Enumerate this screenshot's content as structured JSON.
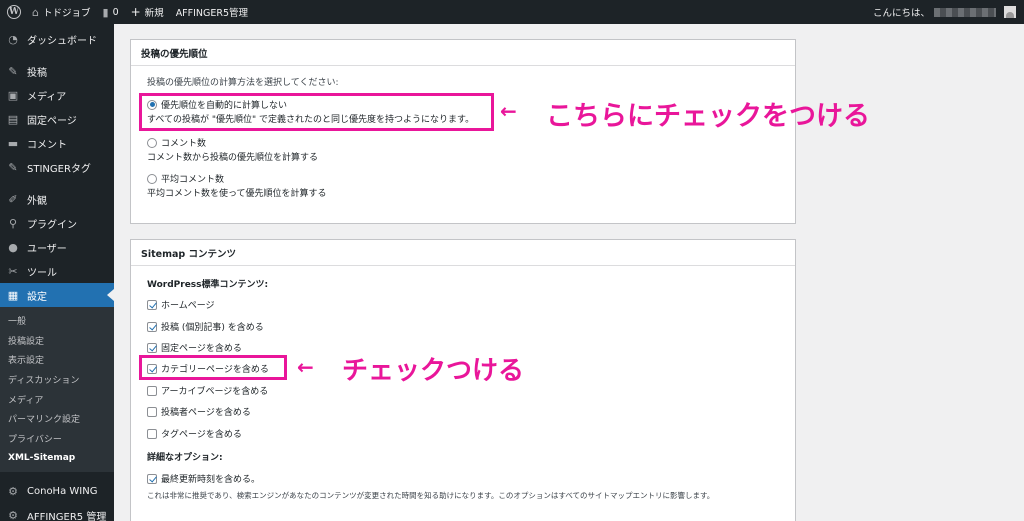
{
  "adminbar": {
    "site_name": "トドジョブ",
    "comments_count": "0",
    "new_label": "新規",
    "affinger_label": "AFFINGER5管理",
    "greeting": "こんにちは、"
  },
  "sidebar": {
    "items": [
      {
        "label": "ダッシュボード",
        "icon": "dashboard-icon",
        "glyph": "◔"
      },
      {
        "label": "投稿",
        "icon": "pin-icon",
        "glyph": "✎"
      },
      {
        "label": "メディア",
        "icon": "media-icon",
        "glyph": "▣"
      },
      {
        "label": "固定ページ",
        "icon": "page-icon",
        "glyph": "▤"
      },
      {
        "label": "コメント",
        "icon": "comment-icon",
        "glyph": "▬"
      },
      {
        "label": "STINGERタグ",
        "icon": "pin-icon",
        "glyph": "✎"
      },
      {
        "label": "外観",
        "icon": "brush-icon",
        "glyph": "✐"
      },
      {
        "label": "プラグイン",
        "icon": "plugin-icon",
        "glyph": "⚲"
      },
      {
        "label": "ユーザー",
        "icon": "user-icon",
        "glyph": "●"
      },
      {
        "label": "ツール",
        "icon": "wrench-icon",
        "glyph": "✂"
      },
      {
        "label": "設定",
        "icon": "settings-icon",
        "glyph": "▦"
      }
    ],
    "submenu": [
      "一般",
      "投稿設定",
      "表示設定",
      "ディスカッション",
      "メディア",
      "パーマリンク設定",
      "プライバシー",
      "XML-Sitemap"
    ],
    "bottom_items": [
      {
        "label": "ConoHa WING",
        "icon": "gear-icon",
        "glyph": "⚙"
      },
      {
        "label": "AFFINGER5 管理",
        "icon": "gear-icon",
        "glyph": "⚙"
      }
    ]
  },
  "priority_panel": {
    "title": "投稿の優先順位",
    "intro": "投稿の優先順位の計算方法を選択してください:",
    "options": [
      {
        "label": "優先順位を自動的に計算しない",
        "desc": "すべての投稿が \"優先順位\" で定義されたのと同じ優先度を持つようになります。",
        "checked": true
      },
      {
        "label": "コメント数",
        "desc": "コメント数から投稿の優先順位を計算する",
        "checked": false
      },
      {
        "label": "平均コメント数",
        "desc": "平均コメント数を使って優先順位を計算する",
        "checked": false
      }
    ]
  },
  "sitemap_panel": {
    "title": "Sitemap コンテンツ",
    "standard_heading": "WordPress標準コンテンツ:",
    "checks": [
      {
        "label": "ホームページ",
        "checked": true
      },
      {
        "label": "投稿 (個別記事) を含める",
        "checked": true
      },
      {
        "label": "固定ページを含める",
        "checked": true
      },
      {
        "label": "カテゴリーページを含める",
        "checked": true
      },
      {
        "label": "アーカイブページを含める",
        "checked": false
      },
      {
        "label": "投稿者ページを含める",
        "checked": false
      },
      {
        "label": "タグページを含める",
        "checked": false
      }
    ],
    "detail_heading": "詳細なオプション:",
    "lastmod_label": "最終更新時刻を含める。",
    "lastmod_checked": true,
    "note": "これは非常に推奨であり、検索エンジンがあなたのコンテンツが変更された時間を知る助けになります。このオプションはすべてのサイトマップエントリに影響します。"
  },
  "annotations": {
    "arrow": "←",
    "first": "こちらにチェックをつける",
    "second": "チェックつける",
    "color": "#e9169a"
  },
  "colors": {
    "accent": "#2271b1",
    "adminbar": "#1d2327",
    "highlight": "#e9169a"
  }
}
